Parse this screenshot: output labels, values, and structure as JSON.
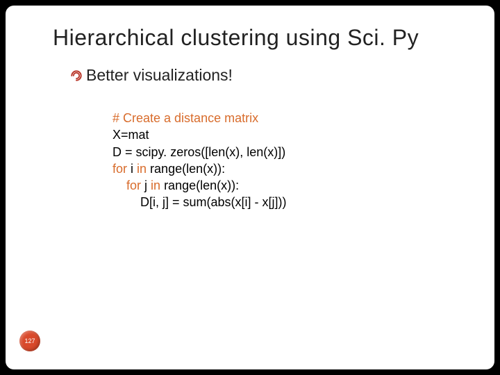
{
  "title": "Hierarchical clustering using Sci. Py",
  "bullet": {
    "text": "Better visualizations!"
  },
  "code": {
    "l1_comment": "# Create a distance matrix",
    "l2": "X=mat",
    "l3": "D = scipy. zeros([len(x), len(x)])",
    "l4_kw": "for",
    "l4_mid": " i ",
    "l4_kw2": "in",
    "l4_rest": " range(len(x)):",
    "l5_pad": "    ",
    "l5_kw": "for",
    "l5_mid": " j ",
    "l5_kw2": "in",
    "l5_rest": " range(len(x)):",
    "l6_pad": "        ",
    "l6": "D[i, j] = sum(abs(x[i] - x[j]))"
  },
  "page_number": "127"
}
